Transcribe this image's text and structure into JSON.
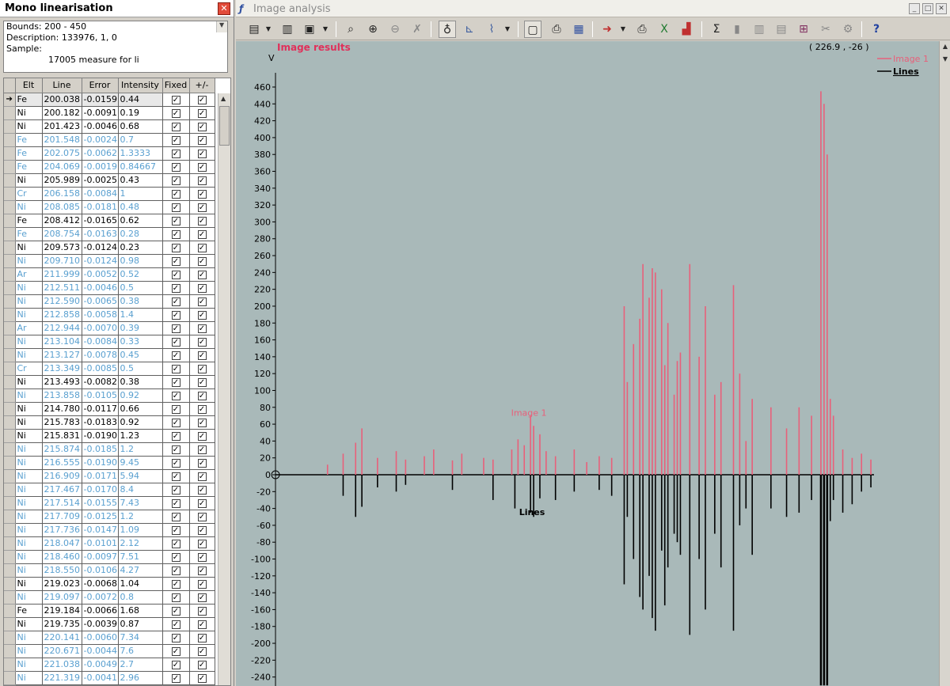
{
  "left_panel": {
    "title": "Mono linearisation",
    "bounds": "Bounds: 200 - 450",
    "description": "Description: 133976, 1, 0",
    "sample_label": "Sample:",
    "sample_value": "17005 measure for li",
    "columns": [
      "Elt",
      "Line",
      "Error",
      "Intensity",
      "Fixed",
      "+/-"
    ],
    "rows": [
      {
        "elt": "Fe",
        "line": "200.038",
        "error": "-0.0159",
        "intensity": "0.44",
        "ref": false,
        "selected": true
      },
      {
        "elt": "Ni",
        "line": "200.182",
        "error": "-0.0091",
        "intensity": "0.19",
        "ref": false
      },
      {
        "elt": "Ni",
        "line": "201.423",
        "error": "-0.0046",
        "intensity": "0.68",
        "ref": false
      },
      {
        "elt": "Fe",
        "line": "201.548",
        "error": "-0.0024",
        "intensity": "0.7",
        "ref": true
      },
      {
        "elt": "Fe",
        "line": "202.075",
        "error": "-0.0062",
        "intensity": "1.3333",
        "ref": true
      },
      {
        "elt": "Fe",
        "line": "204.069",
        "error": "-0.0019",
        "intensity": "0.84667",
        "ref": true
      },
      {
        "elt": "Ni",
        "line": "205.989",
        "error": "-0.0025",
        "intensity": "0.43",
        "ref": false
      },
      {
        "elt": "Cr",
        "line": "206.158",
        "error": "-0.0084",
        "intensity": "1",
        "ref": true
      },
      {
        "elt": "Ni",
        "line": "208.085",
        "error": "-0.0181",
        "intensity": "0.48",
        "ref": true
      },
      {
        "elt": "Fe",
        "line": "208.412",
        "error": "-0.0165",
        "intensity": "0.62",
        "ref": false
      },
      {
        "elt": "Fe",
        "line": "208.754",
        "error": "-0.0163",
        "intensity": "0.28",
        "ref": true
      },
      {
        "elt": "Ni",
        "line": "209.573",
        "error": "-0.0124",
        "intensity": "0.23",
        "ref": false
      },
      {
        "elt": "Ni",
        "line": "209.710",
        "error": "-0.0124",
        "intensity": "0.98",
        "ref": true
      },
      {
        "elt": "Ar",
        "line": "211.999",
        "error": "-0.0052",
        "intensity": "0.52",
        "ref": true
      },
      {
        "elt": "Ni",
        "line": "212.511",
        "error": "-0.0046",
        "intensity": "0.5",
        "ref": true
      },
      {
        "elt": "Ni",
        "line": "212.590",
        "error": "-0.0065",
        "intensity": "0.38",
        "ref": true
      },
      {
        "elt": "Ni",
        "line": "212.858",
        "error": "-0.0058",
        "intensity": "1.4",
        "ref": true
      },
      {
        "elt": "Ar",
        "line": "212.944",
        "error": "-0.0070",
        "intensity": "0.39",
        "ref": true
      },
      {
        "elt": "Ni",
        "line": "213.104",
        "error": "-0.0084",
        "intensity": "0.33",
        "ref": true
      },
      {
        "elt": "Ni",
        "line": "213.127",
        "error": "-0.0078",
        "intensity": "0.45",
        "ref": true
      },
      {
        "elt": "Cr",
        "line": "213.349",
        "error": "-0.0085",
        "intensity": "0.5",
        "ref": true
      },
      {
        "elt": "Ni",
        "line": "213.493",
        "error": "-0.0082",
        "intensity": "0.38",
        "ref": false
      },
      {
        "elt": "Ni",
        "line": "213.858",
        "error": "-0.0105",
        "intensity": "0.92",
        "ref": true
      },
      {
        "elt": "Ni",
        "line": "214.780",
        "error": "-0.0117",
        "intensity": "0.66",
        "ref": false
      },
      {
        "elt": "Ni",
        "line": "215.783",
        "error": "-0.0183",
        "intensity": "0.92",
        "ref": false
      },
      {
        "elt": "Ni",
        "line": "215.831",
        "error": "-0.0190",
        "intensity": "1.23",
        "ref": false
      },
      {
        "elt": "Ni",
        "line": "215.874",
        "error": "-0.0185",
        "intensity": "1.2",
        "ref": true
      },
      {
        "elt": "Ni",
        "line": "216.555",
        "error": "-0.0190",
        "intensity": "9.45",
        "ref": true
      },
      {
        "elt": "Ni",
        "line": "216.909",
        "error": "-0.0171",
        "intensity": "5.94",
        "ref": true
      },
      {
        "elt": "Ni",
        "line": "217.467",
        "error": "-0.0170",
        "intensity": "8.4",
        "ref": true
      },
      {
        "elt": "Ni",
        "line": "217.514",
        "error": "-0.0155",
        "intensity": "7.43",
        "ref": true
      },
      {
        "elt": "Ni",
        "line": "217.709",
        "error": "-0.0125",
        "intensity": "1.2",
        "ref": true
      },
      {
        "elt": "Ni",
        "line": "217.736",
        "error": "-0.0147",
        "intensity": "1.09",
        "ref": true
      },
      {
        "elt": "Ni",
        "line": "218.047",
        "error": "-0.0101",
        "intensity": "2.12",
        "ref": true
      },
      {
        "elt": "Ni",
        "line": "218.460",
        "error": "-0.0097",
        "intensity": "7.51",
        "ref": true
      },
      {
        "elt": "Ni",
        "line": "218.550",
        "error": "-0.0106",
        "intensity": "4.27",
        "ref": true
      },
      {
        "elt": "Ni",
        "line": "219.023",
        "error": "-0.0068",
        "intensity": "1.04",
        "ref": false
      },
      {
        "elt": "Ni",
        "line": "219.097",
        "error": "-0.0072",
        "intensity": "0.8",
        "ref": true
      },
      {
        "elt": "Fe",
        "line": "219.184",
        "error": "-0.0066",
        "intensity": "1.68",
        "ref": false
      },
      {
        "elt": "Ni",
        "line": "219.735",
        "error": "-0.0039",
        "intensity": "0.87",
        "ref": false
      },
      {
        "elt": "Ni",
        "line": "220.141",
        "error": "-0.0060",
        "intensity": "7.34",
        "ref": true
      },
      {
        "elt": "Ni",
        "line": "220.671",
        "error": "-0.0044",
        "intensity": "7.6",
        "ref": true
      },
      {
        "elt": "Ni",
        "line": "221.038",
        "error": "-0.0049",
        "intensity": "2.7",
        "ref": true
      },
      {
        "elt": "Ni",
        "line": "221.319",
        "error": "-0.0041",
        "intensity": "2.96",
        "ref": true
      }
    ]
  },
  "right_window": {
    "title": "Image analysis",
    "toolbar_icons": [
      "table-view-icon",
      "dropdown-icon",
      "grid-icon",
      "image-export-icon",
      "dropdown-icon",
      "zoom-icon",
      "zoom-in-icon",
      "zoom-out-icon",
      "clear-icon",
      "cursor-icon",
      "axes-icon",
      "chart-options-icon",
      "dropdown-icon",
      "monitor-icon",
      "print-setup-icon",
      "calculator-icon",
      "export-icon",
      "dropdown-icon",
      "print-icon",
      "excel-icon",
      "bar-chart-icon",
      "sum-icon",
      "column-icon",
      "spectrum-icon",
      "panel-icon",
      "axis-scale-icon",
      "cut-icon",
      "settings-icon",
      "help-icon"
    ]
  },
  "chart_data": {
    "type": "bar",
    "title": "Image results",
    "ylabel": "V",
    "cursor_readout": "( 226.9 , -26 )",
    "ylim": [
      -250,
      480
    ],
    "yticks": [
      460,
      440,
      420,
      400,
      380,
      360,
      340,
      320,
      300,
      280,
      260,
      240,
      220,
      200,
      180,
      160,
      140,
      120,
      100,
      80,
      60,
      40,
      20,
      0,
      -20,
      -40,
      -60,
      -80,
      -100,
      -120,
      -140,
      -160,
      -180,
      -200,
      -220,
      -240
    ],
    "legend": [
      {
        "name": "Image 1",
        "color": "#e8607a"
      },
      {
        "name": "Lines",
        "color": "#000000"
      }
    ],
    "annotations": [
      {
        "text": "Image 1",
        "x": 71,
        "y": 70,
        "color": "#e8607a"
      },
      {
        "text": "Lines",
        "x": 72,
        "y": -48,
        "color": "#000000"
      }
    ],
    "x_range": [
      0,
      180
    ],
    "series": [
      {
        "name": "Image 1",
        "color": "#e8607a",
        "x": [
          5,
          10,
          14,
          16,
          21,
          27,
          30,
          36,
          39,
          45,
          48,
          55,
          58,
          64,
          66,
          68,
          70,
          71,
          73,
          75,
          78,
          84,
          88,
          92,
          96,
          100,
          101,
          103,
          105,
          106,
          108,
          109,
          110,
          112,
          113,
          114,
          116,
          117,
          118,
          121,
          124,
          126,
          129,
          131,
          135,
          137,
          139,
          141,
          147,
          152,
          156,
          160,
          163,
          164,
          165,
          166,
          167,
          170,
          173,
          176,
          179
        ],
        "values": [
          12,
          25,
          38,
          55,
          20,
          28,
          18,
          22,
          30,
          17,
          25,
          20,
          18,
          30,
          42,
          35,
          70,
          58,
          48,
          28,
          22,
          30,
          15,
          22,
          20,
          200,
          110,
          155,
          185,
          250,
          210,
          245,
          240,
          220,
          130,
          180,
          95,
          135,
          145,
          250,
          140,
          200,
          95,
          110,
          225,
          120,
          40,
          90,
          80,
          55,
          80,
          70,
          455,
          440,
          380,
          90,
          70,
          30,
          20,
          25,
          18
        ]
      },
      {
        "name": "Lines",
        "color": "#000000",
        "x": [
          10,
          14,
          16,
          21,
          27,
          30,
          45,
          58,
          65,
          70,
          71,
          73,
          78,
          84,
          92,
          96,
          100,
          101,
          103,
          105,
          106,
          108,
          109,
          110,
          112,
          113,
          114,
          116,
          117,
          118,
          121,
          124,
          126,
          129,
          131,
          135,
          137,
          139,
          141,
          147,
          152,
          156,
          160,
          163,
          164,
          165,
          166,
          167,
          170,
          173,
          176,
          179
        ],
        "values": [
          -25,
          -50,
          -38,
          -15,
          -20,
          -12,
          -18,
          -30,
          -40,
          -45,
          -50,
          -28,
          -30,
          -20,
          -18,
          -25,
          -130,
          -50,
          -100,
          -145,
          -160,
          -120,
          -170,
          -185,
          -90,
          -155,
          -110,
          -70,
          -80,
          -95,
          -190,
          -100,
          -160,
          -70,
          -110,
          -185,
          -60,
          -40,
          -95,
          -40,
          -50,
          -45,
          -30,
          -250,
          -250,
          -250,
          -55,
          -30,
          -45,
          -35,
          -20,
          -15
        ]
      }
    ]
  }
}
